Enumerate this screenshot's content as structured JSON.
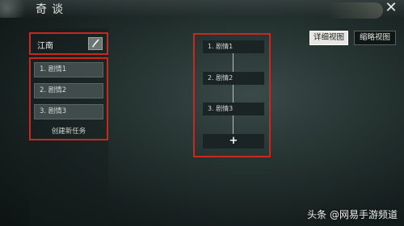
{
  "header": {
    "title": "奇谈",
    "close_icon": "✕"
  },
  "region": {
    "name": "江南",
    "edit_icon": "brush-icon"
  },
  "tasks": {
    "items": [
      {
        "label": "1. 剧情1"
      },
      {
        "label": "2. 剧情2"
      },
      {
        "label": "3. 剧情3"
      }
    ],
    "create_label": "创建新任务"
  },
  "flow": {
    "nodes": [
      {
        "label": "1. 剧情1"
      },
      {
        "label": "2. 剧情2"
      },
      {
        "label": "3. 剧情3"
      }
    ],
    "add_label": "+"
  },
  "view_toggle": {
    "detail_label": "详细视图",
    "thumb_label": "缩略视图",
    "selected": "详细视图"
  },
  "watermark": "头条 @网易手游频道",
  "colors": {
    "highlight_border": "#c8281e",
    "panel_bg": "#1b2424"
  }
}
